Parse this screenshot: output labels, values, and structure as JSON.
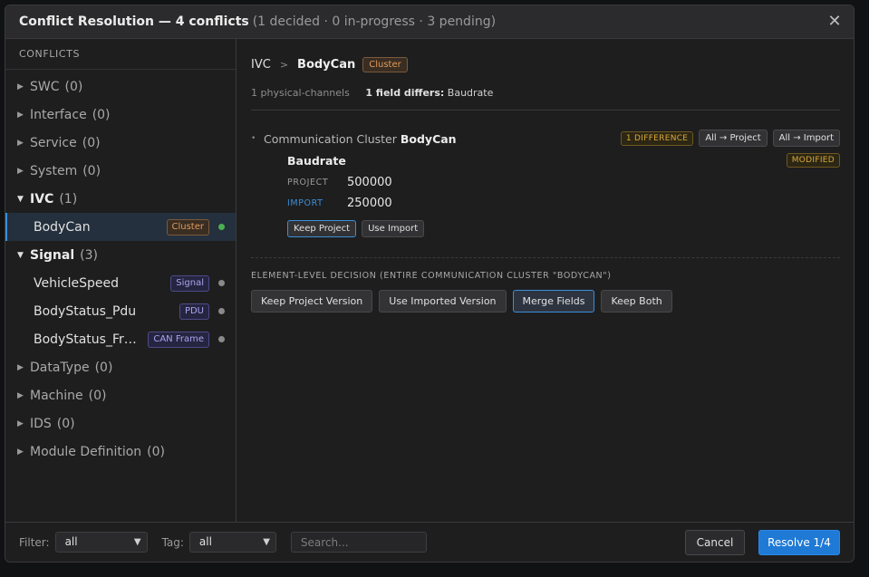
{
  "title": {
    "main": "Conflict Resolution — 4 conflicts",
    "sub": "(1 decided · 0 in-progress · 3 pending)"
  },
  "sidebar": {
    "header": "CONFLICTS",
    "categories": [
      {
        "label": "SWC",
        "count": "(0)"
      },
      {
        "label": "Interface",
        "count": "(0)"
      },
      {
        "label": "Service",
        "count": "(0)"
      },
      {
        "label": "System",
        "count": "(0)"
      },
      {
        "label": "IVC",
        "count": "(1)"
      },
      {
        "label": "Signal",
        "count": "(3)"
      },
      {
        "label": "DataType",
        "count": "(0)"
      },
      {
        "label": "Machine",
        "count": "(0)"
      },
      {
        "label": "IDS",
        "count": "(0)"
      },
      {
        "label": "Module Definition",
        "count": "(0)"
      }
    ],
    "ivc_items": [
      {
        "name": "BodyCan",
        "tag": "Cluster",
        "status_color": "#4caf50"
      }
    ],
    "signal_items": [
      {
        "name": "VehicleSpeed",
        "tag": "Signal",
        "status_color": "#8a8a8a"
      },
      {
        "name": "BodyStatus_Pdu",
        "tag": "PDU",
        "status_color": "#8a8a8a"
      },
      {
        "name": "BodyStatus_Fra…",
        "tag": "CAN Frame",
        "status_color": "#8a8a8a"
      }
    ]
  },
  "main": {
    "breadcrumb": {
      "root": "IVC",
      "separator": ">",
      "current": "BodyCan",
      "tag": "Cluster"
    },
    "meta": {
      "channels": "1 physical-channels",
      "differs_label": "1 field differs:",
      "differs_value": "Baudrate"
    },
    "section": {
      "prefix": "Communication Cluster",
      "name": "BodyCan",
      "diff_badge": "1 DIFFERENCE",
      "all_project": "All → Project",
      "all_import": "All → Import"
    },
    "field": {
      "name": "Baudrate",
      "status": "MODIFIED",
      "project_key": "PROJECT",
      "project_value": "500000",
      "import_key": "IMPORT",
      "import_value": "250000",
      "keep_project": "Keep Project",
      "use_import": "Use Import"
    },
    "decision": {
      "label": "ELEMENT-LEVEL DECISION (ENTIRE COMMUNICATION CLUSTER \"BODYCAN\")",
      "options": [
        "Keep Project Version",
        "Use Imported Version",
        "Merge Fields",
        "Keep Both"
      ],
      "selected": "Merge Fields"
    }
  },
  "footer": {
    "filter_label": "Filter:",
    "filter_value": "all",
    "tag_label": "Tag:",
    "tag_value": "all",
    "search_placeholder": "Search...",
    "cancel": "Cancel",
    "resolve": "Resolve 1/4"
  },
  "colors": {
    "accent": "#1f7ad6",
    "cluster_tag": "#e09a5a",
    "badge_yellow": "#d9a93a"
  }
}
